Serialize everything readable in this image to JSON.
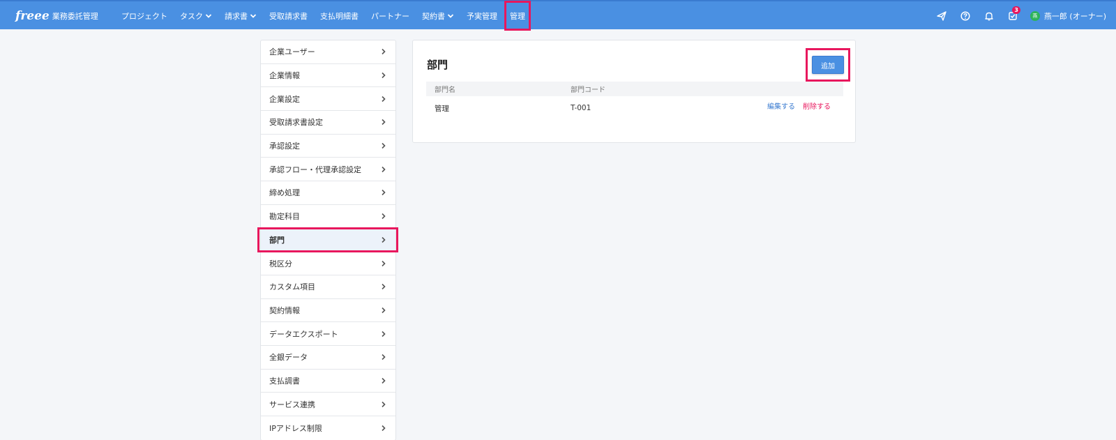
{
  "header": {
    "logo_mark": "freee",
    "logo_sub": "業務委託管理",
    "nav": [
      {
        "label": "プロジェクト",
        "dropdown": false
      },
      {
        "label": "タスク",
        "dropdown": true
      },
      {
        "label": "請求書",
        "dropdown": true
      },
      {
        "label": "受取請求書",
        "dropdown": false
      },
      {
        "label": "支払明細書",
        "dropdown": false
      },
      {
        "label": "パートナー",
        "dropdown": false
      },
      {
        "label": "契約書",
        "dropdown": true
      },
      {
        "label": "予実管理",
        "dropdown": false
      },
      {
        "label": "管理",
        "dropdown": false,
        "highlighted": true
      }
    ],
    "tools": [
      "send-icon",
      "help-icon",
      "bell-icon",
      "task-check-icon"
    ],
    "task_badge": "3",
    "user_initial": "燕",
    "user_name": "燕一郎 (オーナー)"
  },
  "sidebar": {
    "items": [
      {
        "label": "企業ユーザー"
      },
      {
        "label": "企業情報"
      },
      {
        "label": "企業設定"
      },
      {
        "label": "受取請求書設定"
      },
      {
        "label": "承認設定"
      },
      {
        "label": "承認フロー・代理承認設定"
      },
      {
        "label": "締め処理"
      },
      {
        "label": "勘定科目"
      },
      {
        "label": "部門",
        "active": true
      },
      {
        "label": "税区分"
      },
      {
        "label": "カスタム項目"
      },
      {
        "label": "契約情報"
      },
      {
        "label": "データエクスポート"
      },
      {
        "label": "全銀データ"
      },
      {
        "label": "支払調書"
      },
      {
        "label": "サービス連携"
      },
      {
        "label": "IPアドレス制限"
      }
    ]
  },
  "main": {
    "title": "部門",
    "add_label": "追加",
    "columns": [
      "部門名",
      "部門コード"
    ],
    "rows": [
      {
        "name": "管理",
        "code": "T-001",
        "edit": "編集する",
        "delete": "削除する"
      }
    ]
  },
  "colors": {
    "header_bg": "#4a90e2",
    "highlight": "#e8175d",
    "link": "#3a7bd0",
    "danger": "#e8175d"
  }
}
